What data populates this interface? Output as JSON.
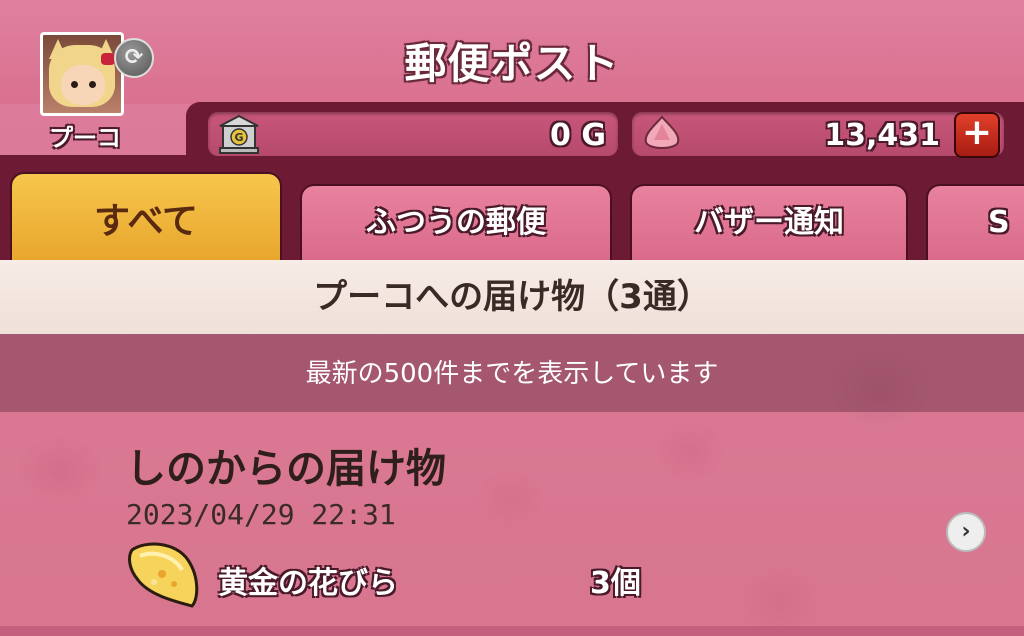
{
  "header": {
    "title": "郵便ポスト",
    "player_name": "プーコ"
  },
  "currency": {
    "gold_value": "0 G",
    "gem_value": "13,431"
  },
  "icons": {
    "refresh": "refresh-icon",
    "bank": "bank-icon",
    "gem": "gem-icon",
    "plus": "plus-icon",
    "petal": "golden-petal-icon",
    "chevron": "chevron-right-icon"
  },
  "tabs": [
    {
      "label": "すべて",
      "active": true
    },
    {
      "label": "ふつうの郵便",
      "active": false
    },
    {
      "label": "バザー通知",
      "active": false
    },
    {
      "label": "S",
      "active": false
    }
  ],
  "section": {
    "title": "プーコへの届け物（3通）",
    "notice": "最新の500件までを表示しています"
  },
  "mail": {
    "title": "しのからの届け物",
    "date": "2023/04/29  22:31",
    "item_name": "黄金の花びら",
    "item_qty": "3個"
  },
  "colors": {
    "background": "#d97a98",
    "dark_band": "#6d1a34",
    "active_tab": "#f7c64c",
    "plus_button": "#c8281a"
  }
}
